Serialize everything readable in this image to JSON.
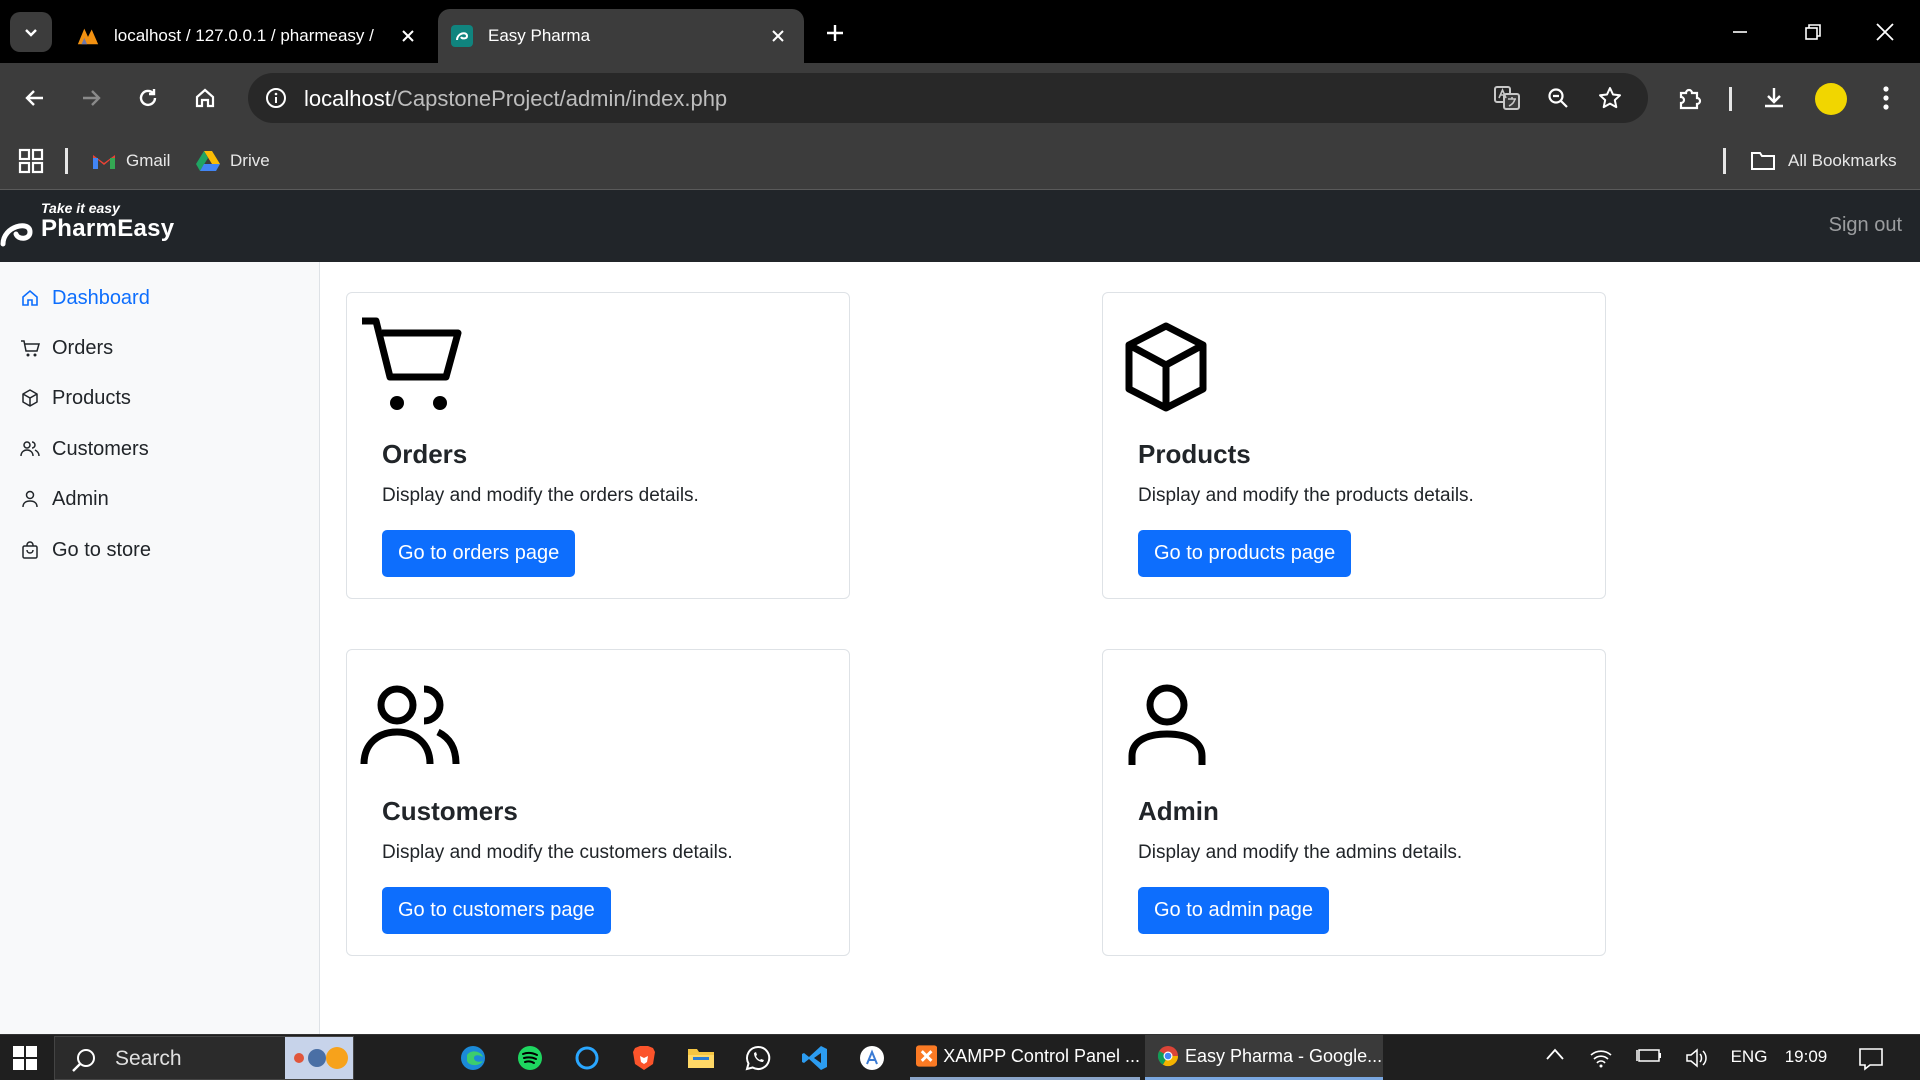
{
  "browser": {
    "tabs": [
      {
        "title": "localhost / 127.0.0.1 / pharmeasy /",
        "active": false
      },
      {
        "title": "Easy Pharma",
        "active": true
      }
    ],
    "url_host": "localhost",
    "url_path": "/CapstoneProject/admin/index.php",
    "bookmarks": [
      {
        "label": "Gmail"
      },
      {
        "label": "Drive"
      }
    ],
    "all_bookmarks_label": "All Bookmarks",
    "profile_color": "#f1d600"
  },
  "app": {
    "brand_tagline": "Take it easy",
    "brand_name": "PharmEasy",
    "signout_label": "Sign out",
    "accent_color": "#0d6efd",
    "sidebar": {
      "items": [
        {
          "label": "Dashboard",
          "icon": "house-icon",
          "active": true
        },
        {
          "label": "Orders",
          "icon": "cart-icon",
          "active": false
        },
        {
          "label": "Products",
          "icon": "box-icon",
          "active": false
        },
        {
          "label": "Customers",
          "icon": "people-icon",
          "active": false
        },
        {
          "label": "Admin",
          "icon": "person-icon",
          "active": false
        },
        {
          "label": "Go to store",
          "icon": "bag-icon",
          "active": false
        }
      ]
    },
    "cards": [
      {
        "title": "Orders",
        "text": "Display and modify the orders details.",
        "button": "Go to orders page",
        "icon": "cart-icon"
      },
      {
        "title": "Products",
        "text": "Display and modify the products details.",
        "button": "Go to products page",
        "icon": "box-icon"
      },
      {
        "title": "Customers",
        "text": "Display and modify the customers details.",
        "button": "Go to customers page",
        "icon": "people-icon"
      },
      {
        "title": "Admin",
        "text": "Display and modify the admins details.",
        "button": "Go to admin page",
        "icon": "person-icon"
      }
    ]
  },
  "taskbar": {
    "search_label": "Search",
    "windows": [
      {
        "label": "XAMPP Control Panel ..."
      },
      {
        "label": "Easy Pharma - Google..."
      }
    ],
    "language": "ENG",
    "time": "19:09"
  }
}
